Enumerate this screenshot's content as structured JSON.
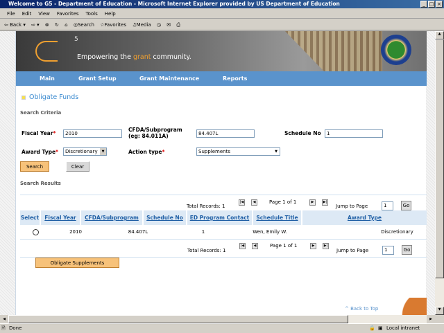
{
  "window": {
    "title": "Welcome to G5 - Department of Education - Microsoft Internet Explorer provided by US Department of Education"
  },
  "menu": [
    "File",
    "Edit",
    "View",
    "Favorites",
    "Tools",
    "Help"
  ],
  "toolbar": {
    "back": "Back",
    "search": "Search",
    "favorites": "Favorites",
    "media": "Media"
  },
  "banner": {
    "logo": "G5",
    "tagline_pre": "Empowering the ",
    "tagline_accent": "grant",
    "tagline_post": " community."
  },
  "nav": [
    "Main",
    "Grant Setup",
    "Grant Maintenance",
    "Reports"
  ],
  "page_title": "Obligate Funds",
  "search_criteria": {
    "heading": "Search Criteria",
    "fiscal_year_label": "Fiscal Year",
    "fiscal_year": "2010",
    "cfda_label": "CFDA/Subprogram",
    "cfda_hint": "(eg: 84.011A)",
    "cfda": "84.407L",
    "schedule_label": "Schedule No",
    "schedule": "1",
    "award_type_label": "Award Type",
    "award_type": "Discretionary",
    "action_type_label": "Action type",
    "action_type": "Supplements",
    "required": "*",
    "search": "Search",
    "clear": "Clear"
  },
  "results": {
    "heading": "Search Results",
    "total": "Total Records: 1",
    "page": "Page 1 of 1",
    "jump": "Jump to Page",
    "jump_value": "1",
    "go": "Go",
    "columns": [
      "Select",
      "Fiscal Year",
      "CFDA/Subprogram",
      "Schedule No",
      "ED Program Contact",
      "Schedule Title",
      "Award Type"
    ],
    "rows": [
      {
        "fiscal_year": "2010",
        "cfda": "84.407L",
        "schedule": "1",
        "contact": "Wen, Emily W.",
        "title": "",
        "award_type": "Discretionary"
      }
    ]
  },
  "obligate_button": "Obligate Supplements",
  "back_to_top": "^ Back to Top",
  "status": {
    "text": "Done",
    "zone": "Local intranet"
  },
  "colors": {
    "nav": "#5a93cc",
    "accent": "#f7c27a",
    "link": "#1f5fa5"
  }
}
